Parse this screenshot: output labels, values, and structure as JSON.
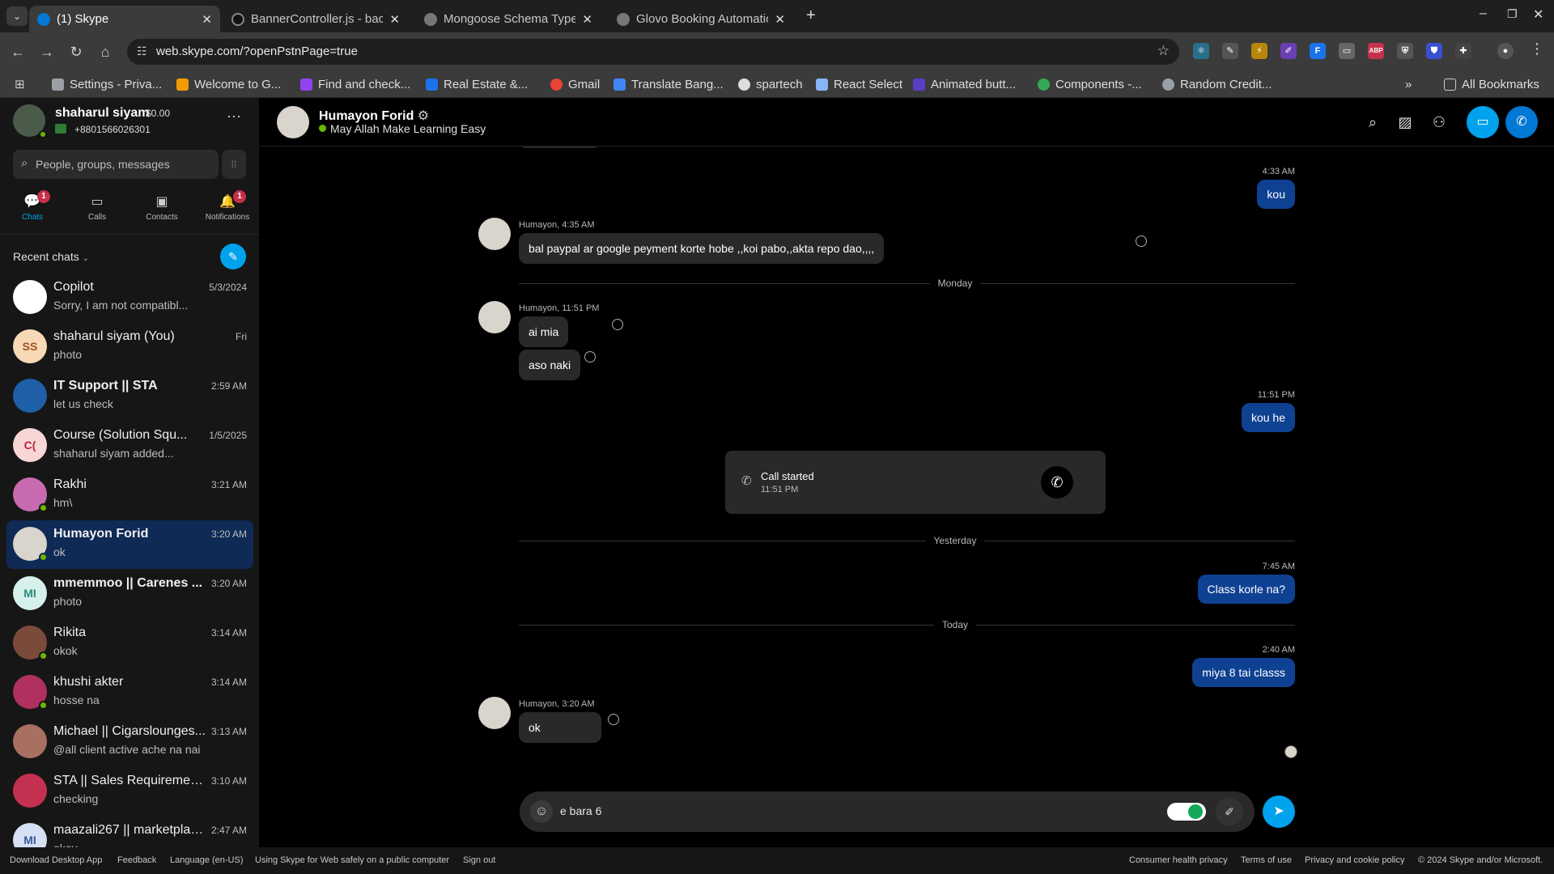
{
  "browser": {
    "tabs": [
      {
        "title": "(1) Skype",
        "active": true,
        "color": "#0078d4"
      },
      {
        "title": "BannerController.js - bac",
        "active": false,
        "color": "#1f1f1f"
      },
      {
        "title": "Mongoose Schema Type",
        "active": false,
        "color": "#777777"
      },
      {
        "title": "Glovo Booking Automatio",
        "active": false,
        "color": "#777777"
      }
    ],
    "url": "web.skype.com/?openPstnPage=true",
    "bookmarks": [
      {
        "label": "Settings - Priva...",
        "color": "#9aa0a6"
      },
      {
        "label": "Welcome to G...",
        "color": "#f29900"
      },
      {
        "label": "Find and check...",
        "color": "#8e44ef"
      },
      {
        "label": "Real Estate &...",
        "color": "#1a73e8"
      },
      {
        "label": "Gmail",
        "color": "#ea4335"
      },
      {
        "label": "Translate Bang...",
        "color": "#4285f4"
      },
      {
        "label": "spartech",
        "color": "#dddddd"
      },
      {
        "label": "React Select",
        "color": "#8ab4f8"
      },
      {
        "label": "Animated butt...",
        "color": "#5b3cc4"
      },
      {
        "label": "Components -...",
        "color": "#34a853"
      },
      {
        "label": "Random Credit...",
        "color": "#9aa0a6"
      }
    ],
    "all_bookmarks": "All Bookmarks"
  },
  "profile": {
    "name": "shaharul siyam",
    "balance": "$0.00",
    "phone": "+8801566026301"
  },
  "search": {
    "placeholder": "People, groups, messages"
  },
  "nav": {
    "chats": "Chats",
    "chats_badge": "1",
    "calls": "Calls",
    "contacts": "Contacts",
    "notifications": "Notifications",
    "notifications_badge": "1"
  },
  "recent_label": "Recent chats",
  "chats": [
    {
      "name": "Copilot",
      "preview": "Sorry, I am not compatibl...",
      "time": "5/3/2024",
      "initials": "",
      "avbg": "#ffffff",
      "avfg": "#000000",
      "bold": false,
      "online": false
    },
    {
      "name": "shaharul siyam (You)",
      "preview": "photo",
      "time": "Fri",
      "initials": "SS",
      "avbg": "#f7d9b5",
      "avfg": "#a0521f",
      "bold": false,
      "online": false
    },
    {
      "name": "IT Support || STA",
      "preview": "let us check",
      "time": "2:59 AM",
      "initials": "",
      "avbg": "#1f5fa8",
      "avfg": "#ffffff",
      "bold": true,
      "online": false
    },
    {
      "name": "Course (Solution Squ...",
      "preview": "shaharul siyam added...",
      "time": "1/5/2025",
      "initials": "C(",
      "avbg": "#f9d6d6",
      "avfg": "#b3283a",
      "bold": false,
      "online": false
    },
    {
      "name": "Rakhi",
      "preview": "hm\\",
      "time": "3:21 AM",
      "initials": "",
      "avbg": "#c86ab0",
      "avfg": "#ffffff",
      "bold": false,
      "online": true
    },
    {
      "name": "Humayon Forid",
      "preview": "ok",
      "time": "3:20 AM",
      "initials": "",
      "avbg": "#d9d4cc",
      "avfg": "#ffffff",
      "bold": true,
      "online": true
    },
    {
      "name": "mmemmoo || Carenes ...",
      "preview": "photo",
      "time": "3:20 AM",
      "initials": "MI",
      "avbg": "#d6f0ec",
      "avfg": "#2a8a7c",
      "bold": true,
      "online": false
    },
    {
      "name": "Rikita",
      "preview": "okok",
      "time": "3:14 AM",
      "initials": "",
      "avbg": "#7a4a3a",
      "avfg": "#ffffff",
      "bold": false,
      "online": true
    },
    {
      "name": "khushi akter",
      "preview": "hosse na",
      "time": "3:14 AM",
      "initials": "",
      "avbg": "#b03060",
      "avfg": "#ffffff",
      "bold": false,
      "online": true
    },
    {
      "name": "Michael || Cigarslounges...",
      "preview": "@all client active ache na nai",
      "time": "3:13 AM",
      "initials": "",
      "avbg": "#a87060",
      "avfg": "#ffffff",
      "bold": false,
      "online": false
    },
    {
      "name": "STA || Sales Requirement...",
      "preview": "checking",
      "time": "3:10 AM",
      "initials": "",
      "avbg": "#c43050",
      "avfg": "#ffffff",
      "bold": false,
      "online": false
    },
    {
      "name": "maazali267 || marketplac...",
      "preview": "okay",
      "time": "2:47 AM",
      "initials": "MI",
      "avbg": "#d6e0f5",
      "avfg": "#3a5a9a",
      "bold": false,
      "online": false
    }
  ],
  "conversation": {
    "name": "Humayon Forid",
    "status": "May Allah Make Learning Easy",
    "messages": {
      "t1": "4:33 AM",
      "m1": "kou",
      "meta2": "Humayon, 4:35 AM",
      "m2": "bal paypal ar google peyment korte hobe ,,koi pabo,,akta repo dao,,,,",
      "div1": "Monday",
      "meta3": "Humayon, 11:51 PM",
      "m3a": "ai mia",
      "m3b": "aso naki",
      "t4": "11:51 PM",
      "m4": "kou he",
      "call_title": "Call started",
      "call_time": "11:51 PM",
      "div2": "Yesterday",
      "t5": "7:45 AM",
      "m5": "Class korle na?",
      "div3": "Today",
      "t6": "2:40 AM",
      "m6": "miya 8 tai classs",
      "meta7": "Humayon, 3:20 AM",
      "m7": "ok"
    },
    "composer_text": "e bara 6"
  },
  "footer": {
    "left": [
      "Download Desktop App",
      "Feedback",
      "Language (en-US)",
      "Using Skype for Web safely on a public computer",
      "Sign out"
    ],
    "right": [
      "Consumer health privacy",
      "Terms of use",
      "Privacy and cookie policy",
      "© 2024 Skype and/or Microsoft."
    ]
  },
  "colors": {
    "accent": "#00a2ed",
    "call_button": "#0078d4",
    "outgoing": "#0f4193",
    "online": "#6bb700",
    "badge": "#c4314b"
  }
}
